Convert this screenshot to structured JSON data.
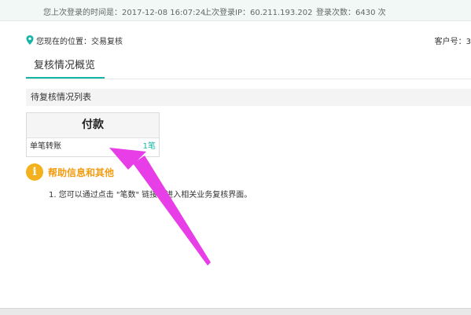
{
  "topbar": {
    "last_login_time_label": "您上次登录的时间是：2017-12-08 16:07:24",
    "last_login_ip_label": "上次登录IP：60.211.193.202",
    "login_count_label": "登录次数：6430 次"
  },
  "location": {
    "text": "您现在的位置：交易复核",
    "customer": "客户号：3"
  },
  "tabs": [
    {
      "label": "复核情况概览",
      "active": true
    }
  ],
  "pending": {
    "section_title": "待复核情况列表",
    "card": {
      "title": "付款",
      "item_name": "单笔转账",
      "item_count": "1笔"
    }
  },
  "help": {
    "title": "帮助信息和其他",
    "items": [
      "1.  您可以通过点击 \"笔数\" 链接，进入相关业务复核界面。"
    ]
  },
  "colors": {
    "accent": "#15b5a6",
    "help_title": "#f39c12",
    "info_icon": "#f3b21d",
    "annotation_arrow": "#e83ee8"
  },
  "icons": {
    "location": "map-pin-icon",
    "help": "info-icon"
  }
}
